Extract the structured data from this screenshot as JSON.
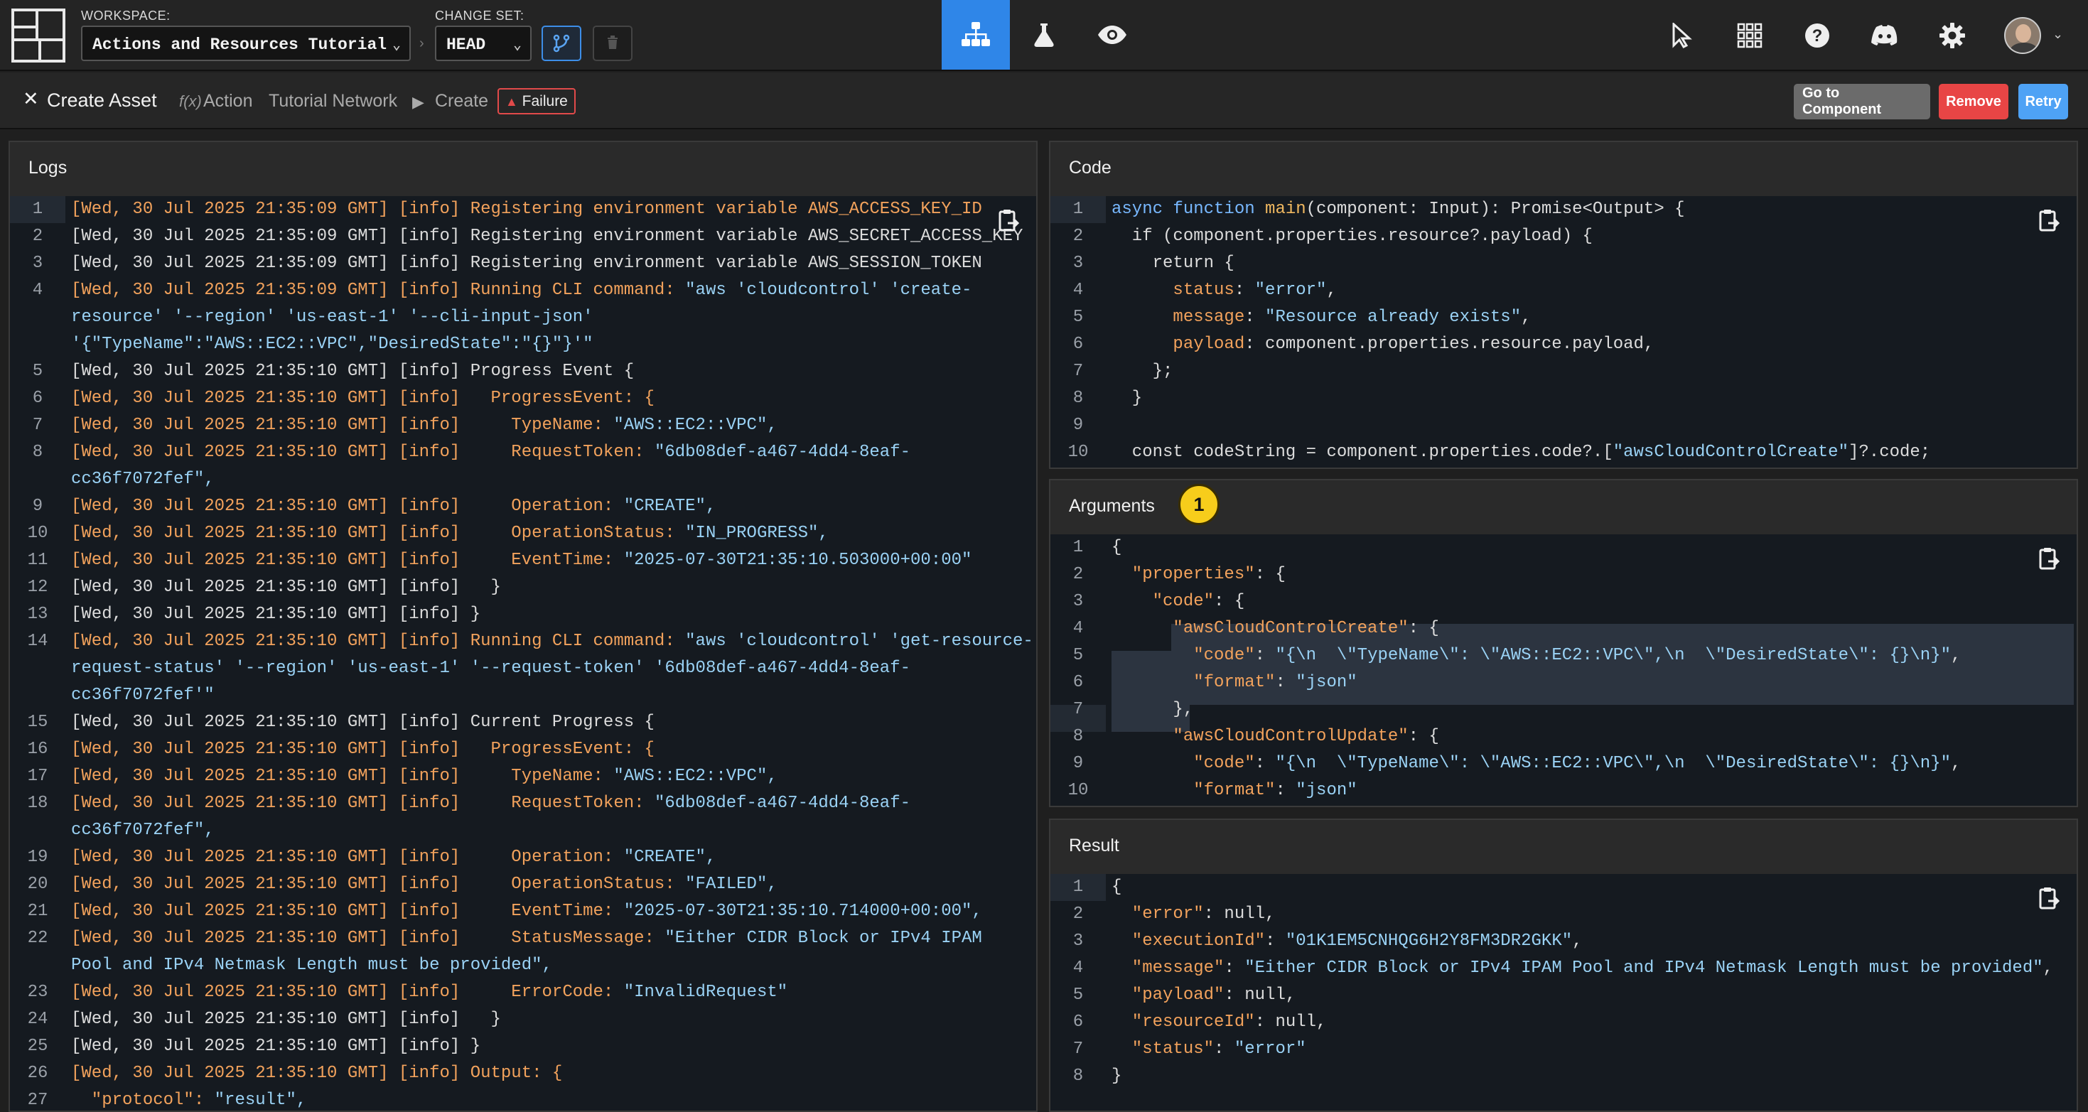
{
  "workspace": {
    "label": "WORKSPACE:",
    "value": "Actions and Resources Tutorial"
  },
  "changeset": {
    "label": "CHANGE SET:",
    "value": "HEAD"
  },
  "subbar": {
    "close": "✕",
    "title": "Create Asset",
    "fx": "f(x)",
    "action": "Action",
    "network": "Tutorial Network",
    "play": "▶",
    "create": "Create",
    "failure": "Failure"
  },
  "buttons": {
    "goto": "Go to Component",
    "remove": "Remove",
    "retry": "Retry"
  },
  "colors": {
    "accent": "#2f86e8",
    "failure": "#e24a4a",
    "badge": "#f7cd1b"
  },
  "logs": {
    "title": "Logs",
    "lines": [
      {
        "n": "1",
        "parts": [
          [
            "ts",
            "[Wed, 30 Jul 2025 21:35:09 GMT] [info] Registering environment variable AWS_ACCESS_KEY_ID"
          ]
        ]
      },
      {
        "n": "2",
        "parts": [
          [
            "tsw",
            "[Wed, 30 Jul 2025 21:35:09 GMT] [info] Registering environment variable AWS_SECRET_ACCESS_KEY"
          ]
        ]
      },
      {
        "n": "3",
        "parts": [
          [
            "tsw",
            "[Wed, 30 Jul 2025 21:35:09 GMT] [info] Registering environment variable AWS_SESSION_TOKEN"
          ]
        ]
      },
      {
        "n": "4",
        "parts": [
          [
            "ts",
            "[Wed, 30 Jul 2025 21:35:09 GMT] [info] Running CLI command: "
          ],
          [
            "s",
            "\"aws 'cloudcontrol' 'create-"
          ]
        ]
      },
      {
        "n": "",
        "parts": [
          [
            "s",
            "resource' '--region' 'us-east-1' '--cli-input-json'"
          ]
        ]
      },
      {
        "n": "",
        "parts": [
          [
            "s",
            "'{\"TypeName\":\"AWS::EC2::VPC\",\"DesiredState\":\"{}\"}'\""
          ]
        ]
      },
      {
        "n": "5",
        "parts": [
          [
            "tsw",
            "[Wed, 30 Jul 2025 21:35:10 GMT] [info] Progress Event {"
          ]
        ]
      },
      {
        "n": "6",
        "parts": [
          [
            "ts",
            "[Wed, 30 Jul 2025 21:35:10 GMT] [info]   ProgressEvent: {"
          ]
        ]
      },
      {
        "n": "7",
        "parts": [
          [
            "ts",
            "[Wed, 30 Jul 2025 21:35:10 GMT] [info]     TypeName: "
          ],
          [
            "s",
            "\"AWS::EC2::VPC\","
          ]
        ]
      },
      {
        "n": "8",
        "parts": [
          [
            "ts",
            "[Wed, 30 Jul 2025 21:35:10 GMT] [info]     RequestToken: "
          ],
          [
            "s",
            "\"6db08def-a467-4dd4-8eaf-"
          ]
        ]
      },
      {
        "n": "",
        "parts": [
          [
            "s",
            "cc36f7072fef\","
          ]
        ]
      },
      {
        "n": "9",
        "parts": [
          [
            "ts",
            "[Wed, 30 Jul 2025 21:35:10 GMT] [info]     Operation: "
          ],
          [
            "s",
            "\"CREATE\","
          ]
        ]
      },
      {
        "n": "10",
        "parts": [
          [
            "ts",
            "[Wed, 30 Jul 2025 21:35:10 GMT] [info]     OperationStatus: "
          ],
          [
            "s",
            "\"IN_PROGRESS\","
          ]
        ]
      },
      {
        "n": "11",
        "parts": [
          [
            "ts",
            "[Wed, 30 Jul 2025 21:35:10 GMT] [info]     EventTime: "
          ],
          [
            "s",
            "\"2025-07-30T21:35:10.503000+00:00\""
          ]
        ]
      },
      {
        "n": "12",
        "parts": [
          [
            "tsw",
            "[Wed, 30 Jul 2025 21:35:10 GMT] [info]   }"
          ]
        ]
      },
      {
        "n": "13",
        "parts": [
          [
            "tsw",
            "[Wed, 30 Jul 2025 21:35:10 GMT] [info] }"
          ]
        ]
      },
      {
        "n": "14",
        "parts": [
          [
            "ts",
            "[Wed, 30 Jul 2025 21:35:10 GMT] [info] Running CLI command: "
          ],
          [
            "s",
            "\"aws 'cloudcontrol' 'get-resource-"
          ]
        ]
      },
      {
        "n": "",
        "parts": [
          [
            "s",
            "request-status' '--region' 'us-east-1' '--request-token' '6db08def-a467-4dd4-8eaf-"
          ]
        ]
      },
      {
        "n": "",
        "parts": [
          [
            "s",
            "cc36f7072fef'\""
          ]
        ]
      },
      {
        "n": "15",
        "parts": [
          [
            "tsw",
            "[Wed, 30 Jul 2025 21:35:10 GMT] [info] Current Progress {"
          ]
        ]
      },
      {
        "n": "16",
        "parts": [
          [
            "ts",
            "[Wed, 30 Jul 2025 21:35:10 GMT] [info]   ProgressEvent: {"
          ]
        ]
      },
      {
        "n": "17",
        "parts": [
          [
            "ts",
            "[Wed, 30 Jul 2025 21:35:10 GMT] [info]     TypeName: "
          ],
          [
            "s",
            "\"AWS::EC2::VPC\","
          ]
        ]
      },
      {
        "n": "18",
        "parts": [
          [
            "ts",
            "[Wed, 30 Jul 2025 21:35:10 GMT] [info]     RequestToken: "
          ],
          [
            "s",
            "\"6db08def-a467-4dd4-8eaf-"
          ]
        ]
      },
      {
        "n": "",
        "parts": [
          [
            "s",
            "cc36f7072fef\","
          ]
        ]
      },
      {
        "n": "19",
        "parts": [
          [
            "ts",
            "[Wed, 30 Jul 2025 21:35:10 GMT] [info]     Operation: "
          ],
          [
            "s",
            "\"CREATE\","
          ]
        ]
      },
      {
        "n": "20",
        "parts": [
          [
            "ts",
            "[Wed, 30 Jul 2025 21:35:10 GMT] [info]     OperationStatus: "
          ],
          [
            "s",
            "\"FAILED\","
          ]
        ]
      },
      {
        "n": "21",
        "parts": [
          [
            "ts",
            "[Wed, 30 Jul 2025 21:35:10 GMT] [info]     EventTime: "
          ],
          [
            "s",
            "\"2025-07-30T21:35:10.714000+00:00\","
          ]
        ]
      },
      {
        "n": "22",
        "parts": [
          [
            "ts",
            "[Wed, 30 Jul 2025 21:35:10 GMT] [info]     StatusMessage: "
          ],
          [
            "s",
            "\"Either CIDR Block or IPv4 IPAM"
          ]
        ]
      },
      {
        "n": "",
        "parts": [
          [
            "s",
            "Pool and IPv4 Netmask Length must be provided\","
          ]
        ]
      },
      {
        "n": "23",
        "parts": [
          [
            "ts",
            "[Wed, 30 Jul 2025 21:35:10 GMT] [info]     ErrorCode: "
          ],
          [
            "s",
            "\"InvalidRequest\""
          ]
        ]
      },
      {
        "n": "24",
        "parts": [
          [
            "tsw",
            "[Wed, 30 Jul 2025 21:35:10 GMT] [info]   }"
          ]
        ]
      },
      {
        "n": "25",
        "parts": [
          [
            "tsw",
            "[Wed, 30 Jul 2025 21:35:10 GMT] [info] }"
          ]
        ]
      },
      {
        "n": "26",
        "parts": [
          [
            "ts",
            "[Wed, 30 Jul 2025 21:35:10 GMT] [info] Output: {"
          ]
        ]
      },
      {
        "n": "27",
        "parts": [
          [
            "ts",
            "  \"protocol\": "
          ],
          [
            "s",
            "\"result\","
          ]
        ]
      }
    ]
  },
  "code": {
    "title": "Code",
    "lines": [
      {
        "n": "1",
        "parts": [
          [
            "k",
            "async function "
          ],
          [
            "fn",
            "main"
          ],
          [
            "tsw",
            "(component: Input): Promise<Output> {"
          ]
        ]
      },
      {
        "n": "2",
        "parts": [
          [
            "tsw",
            "  if (component.properties.resource?.payload) {"
          ]
        ]
      },
      {
        "n": "3",
        "parts": [
          [
            "tsw",
            "    return {"
          ]
        ]
      },
      {
        "n": "4",
        "parts": [
          [
            "ts",
            "      status"
          ],
          [
            "tsw",
            ": "
          ],
          [
            "s",
            "\"error\""
          ],
          [
            "tsw",
            ","
          ]
        ]
      },
      {
        "n": "5",
        "parts": [
          [
            "ts",
            "      message"
          ],
          [
            "tsw",
            ": "
          ],
          [
            "s",
            "\"Resource already exists\""
          ],
          [
            "tsw",
            ","
          ]
        ]
      },
      {
        "n": "6",
        "parts": [
          [
            "ts",
            "      payload"
          ],
          [
            "tsw",
            ": component.properties.resource.payload,"
          ]
        ]
      },
      {
        "n": "7",
        "parts": [
          [
            "tsw",
            "    };"
          ]
        ]
      },
      {
        "n": "8",
        "parts": [
          [
            "tsw",
            "  }"
          ]
        ]
      },
      {
        "n": "9",
        "parts": [
          [
            "tsw",
            ""
          ]
        ]
      },
      {
        "n": "10",
        "parts": [
          [
            "tsw",
            "  const codeString = component.properties.code?.["
          ],
          [
            "s",
            "\"awsCloudControlCreate\""
          ],
          [
            "tsw",
            "]?.code;"
          ]
        ]
      }
    ]
  },
  "arguments": {
    "title": "Arguments",
    "count": "1",
    "lines": [
      {
        "n": "1",
        "parts": [
          [
            "tsw",
            "{"
          ]
        ]
      },
      {
        "n": "2",
        "parts": [
          [
            "ts",
            "  \"properties\""
          ],
          [
            "tsw",
            ": {"
          ]
        ]
      },
      {
        "n": "3",
        "parts": [
          [
            "ts",
            "    \"code\""
          ],
          [
            "tsw",
            ": {"
          ]
        ]
      },
      {
        "n": "4",
        "parts": [
          [
            "ts",
            "      \"awsCloudControlCreate\""
          ],
          [
            "tsw",
            ": {"
          ]
        ]
      },
      {
        "n": "5",
        "parts": [
          [
            "ts",
            "        \"code\""
          ],
          [
            "tsw",
            ": "
          ],
          [
            "s",
            "\"{\\n  \\\"TypeName\\\": \\\"AWS::EC2::VPC\\\",\\n  \\\"DesiredState\\\": {}\\n}\""
          ],
          [
            "tsw",
            ","
          ]
        ]
      },
      {
        "n": "6",
        "parts": [
          [
            "ts",
            "        \"format\""
          ],
          [
            "tsw",
            ": "
          ],
          [
            "s",
            "\"json\""
          ]
        ]
      },
      {
        "n": "7",
        "parts": [
          [
            "tsw",
            "      },"
          ]
        ]
      },
      {
        "n": "8",
        "parts": [
          [
            "ts",
            "      \"awsCloudControlUpdate\""
          ],
          [
            "tsw",
            ": {"
          ]
        ]
      },
      {
        "n": "9",
        "parts": [
          [
            "ts",
            "        \"code\""
          ],
          [
            "tsw",
            ": "
          ],
          [
            "s",
            "\"{\\n  \\\"TypeName\\\": \\\"AWS::EC2::VPC\\\",\\n  \\\"DesiredState\\\": {}\\n}\""
          ],
          [
            "tsw",
            ","
          ]
        ]
      },
      {
        "n": "10",
        "parts": [
          [
            "ts",
            "        \"format\""
          ],
          [
            "tsw",
            ": "
          ],
          [
            "s",
            "\"json\""
          ]
        ]
      }
    ]
  },
  "result": {
    "title": "Result",
    "lines": [
      {
        "n": "1",
        "parts": [
          [
            "tsw",
            "{"
          ]
        ]
      },
      {
        "n": "2",
        "parts": [
          [
            "ts",
            "  \"error\""
          ],
          [
            "tsw",
            ": null,"
          ]
        ]
      },
      {
        "n": "3",
        "parts": [
          [
            "ts",
            "  \"executionId\""
          ],
          [
            "tsw",
            ": "
          ],
          [
            "s",
            "\"01K1EM5CNHQG6H2Y8FM3DR2GKK\""
          ],
          [
            "tsw",
            ","
          ]
        ]
      },
      {
        "n": "4",
        "parts": [
          [
            "ts",
            "  \"message\""
          ],
          [
            "tsw",
            ": "
          ],
          [
            "s",
            "\"Either CIDR Block or IPv4 IPAM Pool and IPv4 Netmask Length must be provided\""
          ],
          [
            "tsw",
            ","
          ]
        ]
      },
      {
        "n": "5",
        "parts": [
          [
            "ts",
            "  \"payload\""
          ],
          [
            "tsw",
            ": null,"
          ]
        ]
      },
      {
        "n": "6",
        "parts": [
          [
            "ts",
            "  \"resourceId\""
          ],
          [
            "tsw",
            ": null,"
          ]
        ]
      },
      {
        "n": "7",
        "parts": [
          [
            "ts",
            "  \"status\""
          ],
          [
            "tsw",
            ": "
          ],
          [
            "s",
            "\"error\""
          ]
        ]
      },
      {
        "n": "8",
        "parts": [
          [
            "tsw",
            "}"
          ]
        ]
      }
    ]
  }
}
